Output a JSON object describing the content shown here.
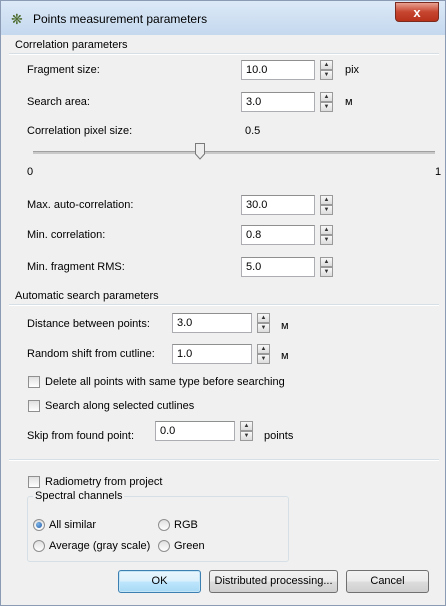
{
  "window": {
    "title": "Points measurement parameters",
    "close": "x"
  },
  "correlation": {
    "group_title": "Correlation parameters",
    "fragment_size": {
      "label": "Fragment size:",
      "value": "10.0",
      "unit": "pix"
    },
    "search_area": {
      "label": "Search area:",
      "value": "3.0",
      "unit": "м"
    },
    "pixel_size": {
      "label": "Correlation pixel size:",
      "value": "0.5",
      "slider_value": 0.5,
      "min_label": "0",
      "max_label": "1"
    },
    "max_autocorr": {
      "label": "Max. auto-correlation:",
      "value": "30.0"
    },
    "min_corr": {
      "label": "Min. correlation:",
      "value": "0.8"
    },
    "min_rms": {
      "label": "Min. fragment RMS:",
      "value": "5.0"
    }
  },
  "auto_search": {
    "group_title": "Automatic search parameters",
    "distance": {
      "label": "Distance between points:",
      "value": "3.0",
      "unit": "м"
    },
    "random_shift": {
      "label": "Random shift from cutline:",
      "value": "1.0",
      "unit": "м"
    },
    "delete_points": {
      "label": "Delete all points with same type before searching",
      "checked": false
    },
    "search_cutlines": {
      "label": "Search along selected cutlines",
      "checked": false
    },
    "skip": {
      "label": "Skip from found point:",
      "value": "0.0",
      "unit": "points"
    }
  },
  "radiometry": {
    "label": "Radiometry from project",
    "checked": false,
    "spectral": {
      "title": "Spectral channels",
      "options": [
        {
          "label": "All similar",
          "selected": true
        },
        {
          "label": "RGB",
          "selected": false
        },
        {
          "label": "Average (gray scale)",
          "selected": false
        },
        {
          "label": "Green",
          "selected": false
        }
      ]
    }
  },
  "buttons": {
    "ok": "OK",
    "distributed": "Distributed processing...",
    "cancel": "Cancel"
  }
}
